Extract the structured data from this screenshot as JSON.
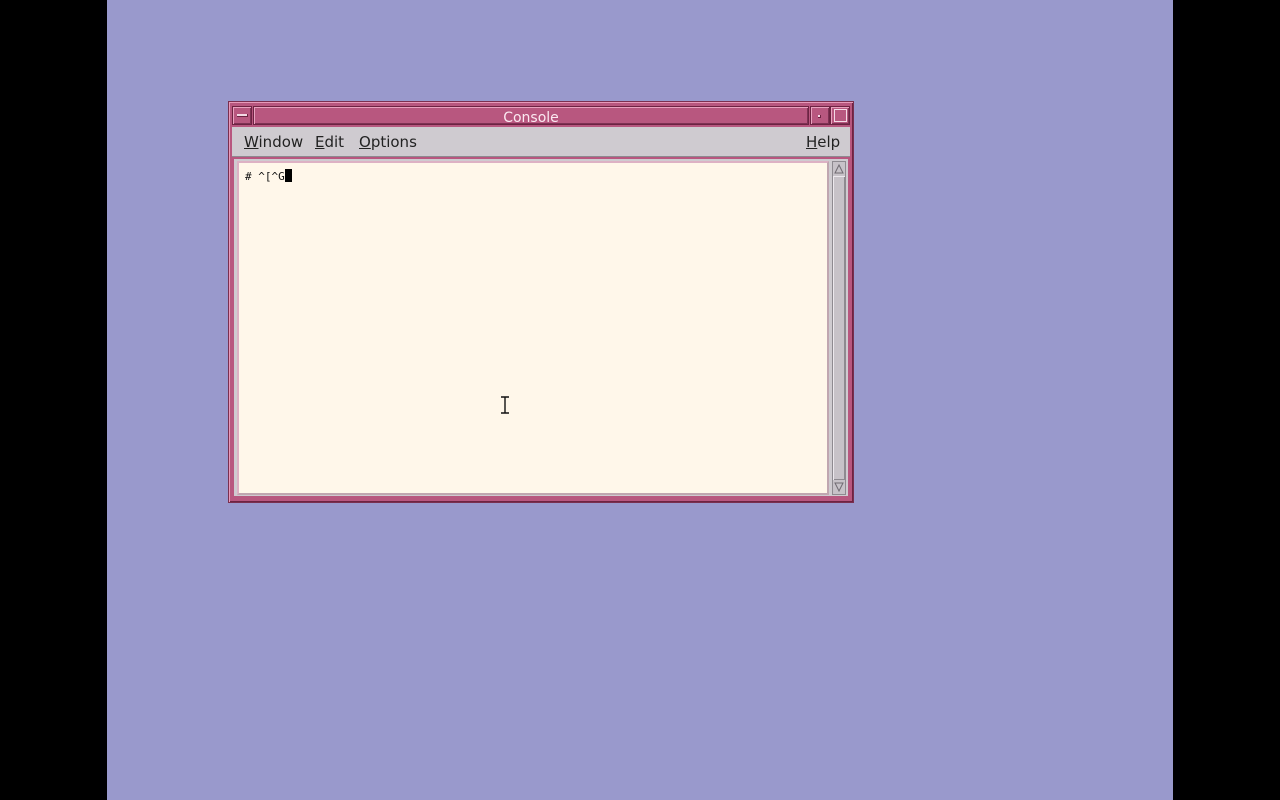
{
  "window": {
    "title": "Console"
  },
  "menubar": {
    "items": [
      {
        "label_mnemonic": "W",
        "label_rest": "indow"
      },
      {
        "label_mnemonic": "E",
        "label_rest": "dit"
      },
      {
        "label_mnemonic": "O",
        "label_rest": "ptions"
      }
    ],
    "help": {
      "label_mnemonic": "H",
      "label_rest": "elp"
    }
  },
  "terminal": {
    "line": "# ^[^G"
  },
  "colors": {
    "desktop": "#9999cc",
    "frame": "#b8577f",
    "terminal_bg": "#fff7ea",
    "menubar_bg": "#cfcbd0"
  },
  "icons": {
    "window_menu": "window-menu-icon",
    "minimize": "minimize-icon",
    "maximize": "maximize-icon",
    "scroll_up": "arrow-up-icon",
    "scroll_down": "arrow-down-icon",
    "pointer": "ibeam-cursor-icon"
  }
}
